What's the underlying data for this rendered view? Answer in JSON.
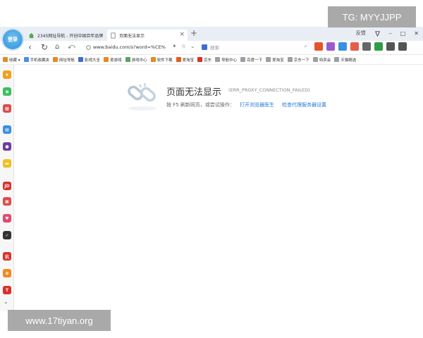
{
  "browser": {
    "logo_label": "登录",
    "tabs": [
      {
        "title": "2345网址导航 - 开创中国百年品牌"
      },
      {
        "title": "页面无法显示"
      }
    ],
    "tab_close_glyph": "×",
    "new_tab_glyph": "+",
    "window": {
      "feedback_label": "反馈",
      "min_glyph": "–",
      "max_glyph": "□",
      "close_glyph": "✕"
    }
  },
  "navbar": {
    "back_glyph": "‹",
    "refresh_glyph": "↻",
    "undo_glyph": "⤺",
    "url": "www.baidu.com/s?word=%CE%",
    "search_placeholder": "搜索",
    "tool_colors": [
      "#e4552a",
      "#9b59d0",
      "#3b8fe0",
      "#e55b4c",
      "#666666",
      "#2e9e44",
      "#555555",
      "#555555"
    ]
  },
  "bookmarks": {
    "colors": {
      "accent": "#e68a1f",
      "blue": "#4a90e2",
      "red": "#d9302b",
      "gray": "#9aa0a6"
    },
    "items": [
      {
        "label": "收藏 ▾",
        "color": "#e68a1f"
      },
      {
        "label": "手机收藏夹",
        "color": "#4a90e2"
      },
      {
        "label": "网址导航",
        "color": "#e68a1f"
      },
      {
        "label": "影视大全",
        "color": "#3b6fd1"
      },
      {
        "label": "爱游戏",
        "color": "#e68a1f"
      },
      {
        "label": "游戏中心",
        "color": "#5aa55a"
      },
      {
        "label": "软件下载",
        "color": "#e68a1f"
      },
      {
        "label": "爱淘宝",
        "color": "#e65c1a"
      },
      {
        "label": "京东",
        "color": "#d9302b"
      },
      {
        "label": "导航中心",
        "color": "#9aa0a6"
      },
      {
        "label": "百度一下",
        "color": "#9aa0a6"
      },
      {
        "label": "爱淘宝",
        "color": "#9aa0a6"
      },
      {
        "label": "京东一下",
        "color": "#9aa0a6"
      },
      {
        "label": "特卖会",
        "color": "#9aa0a6"
      },
      {
        "label": "天猫精选",
        "color": "#9aa0a6"
      }
    ]
  },
  "sidebar": {
    "items": [
      {
        "label": "★",
        "color": "#f0a020"
      },
      {
        "label": "◉",
        "color": "#3bbf5f"
      },
      {
        "label": "▦",
        "color": "#e04a4a"
      },
      {
        "label": "▤",
        "color": "#3b8fe0"
      },
      {
        "label": "●",
        "color": "#6b3fa0"
      },
      {
        "label": "▬",
        "color": "#f0c020"
      },
      {
        "label": "JD",
        "color": "#d9302b"
      },
      {
        "label": "▣",
        "color": "#e04a4a"
      },
      {
        "label": "♥",
        "color": "#e04a70"
      },
      {
        "label": "✓",
        "color": "#333333"
      },
      {
        "label": "抗",
        "color": "#d9302b"
      },
      {
        "label": "⊕",
        "color": "#f08a20"
      },
      {
        "label": "T",
        "color": "#d9302b"
      }
    ],
    "more_glyph": "⌄"
  },
  "error_page": {
    "title": "页面无法显示",
    "code": "(ERR_PROXY_CONNECTION_FAILED)",
    "hint": "按 F5 刷新网页，或尝试操作：",
    "link_doctor": "打开浏览器医生",
    "link_proxy": "检查代理服务器设置"
  },
  "watermarks": {
    "top": "TG: MYYJJPP",
    "bottom": "www.17tiyan.org"
  }
}
